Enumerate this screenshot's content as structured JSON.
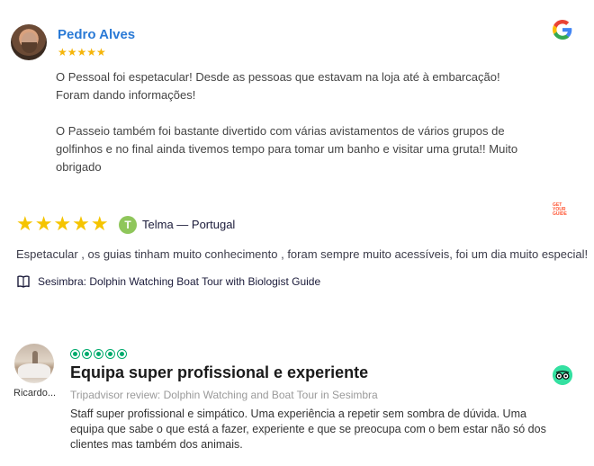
{
  "reviews": {
    "google": {
      "source_icon": "google-logo-icon",
      "reviewer": "Pedro Alves",
      "rating": 5,
      "stars": "★★★★★",
      "paragraph1": "O Pessoal foi espetacular! Desde as pessoas que estavam na loja até à embarcação! Foram dando informações!",
      "paragraph2": "O Passeio também foi bastante divertido com várias avistamentos de vários grupos de golfinhos e no final ainda tivemos tempo para tomar um banho e visitar uma gruta!! Muito obrigado"
    },
    "getyourguide": {
      "source_icon": "getyourguide-logo-icon",
      "source_logo_text": "GET YOUR GUIDE",
      "rating": 5,
      "stars": "★★★★★",
      "reviewer_initial": "T",
      "reviewer": "Telma  — Portugal",
      "text": "Espetacular , os guias tinham muito conhecimento , foram sempre muito acessíveis, foi um dia muito especial!",
      "tour": "Sesimbra: Dolphin Watching Boat Tour with Biologist Guide"
    },
    "tripadvisor": {
      "source_icon": "tripadvisor-logo-icon",
      "reviewer": "Ricardo...",
      "rating": 5,
      "title": "Equipa super profissional e experiente",
      "subtitle": "Tripadvisor review: Dolphin Watching and Boat Tour in Sesimbra",
      "text": "Staff super profissional e simpático. Uma experiência a repetir sem sombra de dúvida. Uma equipa que sabe o que está a fazer, experiente e que se preocupa com o bem estar não só dos clientes mas também dos animais."
    }
  },
  "colors": {
    "google_name": "#2a7ad6",
    "google_star": "#f5b50a",
    "gyg_star": "#f5c400",
    "gyg_badge": "#8fc65b",
    "tripadvisor_green": "#00aa6c",
    "tripadvisor_logo": "#34e0a1"
  }
}
